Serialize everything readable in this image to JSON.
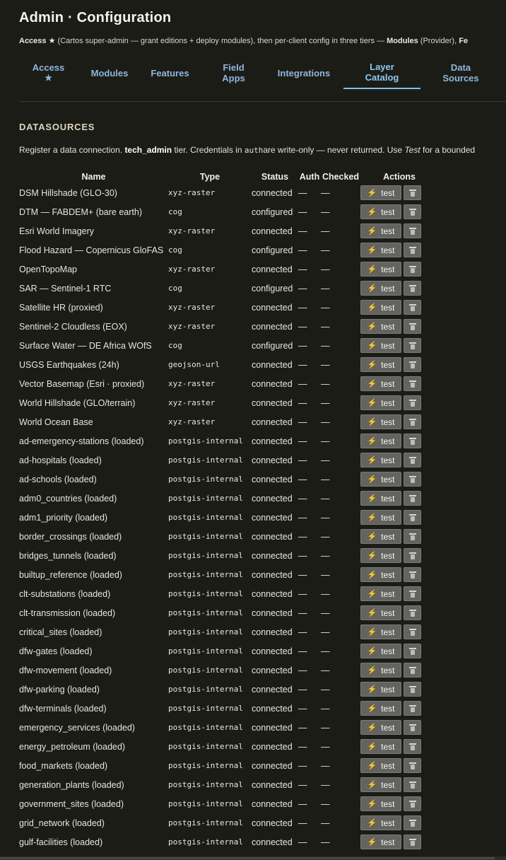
{
  "page": {
    "title": "Admin · Configuration",
    "intro": {
      "access_label": "Access",
      "star": "★",
      "access_text": " (Cartos super-admin — grant editions + deploy modules), then per-client config in three tiers — ",
      "modules_label": "Modules",
      "modules_text": " (Provider), ",
      "tail": "Fe"
    }
  },
  "tabs": [
    {
      "label": "Access",
      "sub": "★"
    },
    {
      "label": "Modules",
      "sub": ""
    },
    {
      "label": "Features",
      "sub": ""
    },
    {
      "label": "Field",
      "sub": "Apps"
    },
    {
      "label": "Integrations",
      "sub": ""
    },
    {
      "label": "Layer",
      "sub": "Catalog"
    },
    {
      "label": "Data",
      "sub": "Sources"
    }
  ],
  "active_tab": "Layer Catalog",
  "datasources": {
    "heading": "DATASOURCES",
    "desc": {
      "p1": "Register a data connection. ",
      "tier": "tech_admin",
      "p2": " tier. Credentials in ",
      "code": "auth",
      "p3": "are write-only — never returned. Use ",
      "test": "Test",
      "p4": " for a bounded"
    },
    "columns": [
      "Name",
      "Type",
      "Status",
      "Auth",
      "Checked",
      "Actions"
    ],
    "test_label": "test",
    "rows": [
      {
        "name": "DSM Hillshade (GLO-30)",
        "type": "xyz-raster",
        "status": "connected",
        "auth": "—",
        "checked": "—"
      },
      {
        "name": "DTM — FABDEM+ (bare earth)",
        "type": "cog",
        "status": "configured",
        "auth": "—",
        "checked": "—"
      },
      {
        "name": "Esri World Imagery",
        "type": "xyz-raster",
        "status": "connected",
        "auth": "—",
        "checked": "—"
      },
      {
        "name": "Flood Hazard — Copernicus GloFAS",
        "type": "cog",
        "status": "configured",
        "auth": "—",
        "checked": "—"
      },
      {
        "name": "OpenTopoMap",
        "type": "xyz-raster",
        "status": "connected",
        "auth": "—",
        "checked": "—"
      },
      {
        "name": "SAR — Sentinel-1 RTC",
        "type": "cog",
        "status": "configured",
        "auth": "—",
        "checked": "—"
      },
      {
        "name": "Satellite HR (proxied)",
        "type": "xyz-raster",
        "status": "connected",
        "auth": "—",
        "checked": "—"
      },
      {
        "name": "Sentinel-2 Cloudless (EOX)",
        "type": "xyz-raster",
        "status": "connected",
        "auth": "—",
        "checked": "—"
      },
      {
        "name": "Surface Water — DE Africa WOfS",
        "type": "cog",
        "status": "configured",
        "auth": "—",
        "checked": "—"
      },
      {
        "name": "USGS Earthquakes (24h)",
        "type": "geojson-url",
        "status": "connected",
        "auth": "—",
        "checked": "—"
      },
      {
        "name": "Vector Basemap (Esri · proxied)",
        "type": "xyz-raster",
        "status": "connected",
        "auth": "—",
        "checked": "—"
      },
      {
        "name": "World Hillshade (GLO/terrain)",
        "type": "xyz-raster",
        "status": "connected",
        "auth": "—",
        "checked": "—"
      },
      {
        "name": "World Ocean Base",
        "type": "xyz-raster",
        "status": "connected",
        "auth": "—",
        "checked": "—"
      },
      {
        "name": "ad-emergency-stations (loaded)",
        "type": "postgis-internal",
        "status": "connected",
        "auth": "—",
        "checked": "—"
      },
      {
        "name": "ad-hospitals (loaded)",
        "type": "postgis-internal",
        "status": "connected",
        "auth": "—",
        "checked": "—"
      },
      {
        "name": "ad-schools (loaded)",
        "type": "postgis-internal",
        "status": "connected",
        "auth": "—",
        "checked": "—"
      },
      {
        "name": "adm0_countries (loaded)",
        "type": "postgis-internal",
        "status": "connected",
        "auth": "—",
        "checked": "—"
      },
      {
        "name": "adm1_priority (loaded)",
        "type": "postgis-internal",
        "status": "connected",
        "auth": "—",
        "checked": "—"
      },
      {
        "name": "border_crossings (loaded)",
        "type": "postgis-internal",
        "status": "connected",
        "auth": "—",
        "checked": "—"
      },
      {
        "name": "bridges_tunnels (loaded)",
        "type": "postgis-internal",
        "status": "connected",
        "auth": "—",
        "checked": "—"
      },
      {
        "name": "builtup_reference (loaded)",
        "type": "postgis-internal",
        "status": "connected",
        "auth": "—",
        "checked": "—"
      },
      {
        "name": "clt-substations (loaded)",
        "type": "postgis-internal",
        "status": "connected",
        "auth": "—",
        "checked": "—"
      },
      {
        "name": "clt-transmission (loaded)",
        "type": "postgis-internal",
        "status": "connected",
        "auth": "—",
        "checked": "—"
      },
      {
        "name": "critical_sites (loaded)",
        "type": "postgis-internal",
        "status": "connected",
        "auth": "—",
        "checked": "—"
      },
      {
        "name": "dfw-gates (loaded)",
        "type": "postgis-internal",
        "status": "connected",
        "auth": "—",
        "checked": "—"
      },
      {
        "name": "dfw-movement (loaded)",
        "type": "postgis-internal",
        "status": "connected",
        "auth": "—",
        "checked": "—"
      },
      {
        "name": "dfw-parking (loaded)",
        "type": "postgis-internal",
        "status": "connected",
        "auth": "—",
        "checked": "—"
      },
      {
        "name": "dfw-terminals (loaded)",
        "type": "postgis-internal",
        "status": "connected",
        "auth": "—",
        "checked": "—"
      },
      {
        "name": "emergency_services (loaded)",
        "type": "postgis-internal",
        "status": "connected",
        "auth": "—",
        "checked": "—"
      },
      {
        "name": "energy_petroleum (loaded)",
        "type": "postgis-internal",
        "status": "connected",
        "auth": "—",
        "checked": "—"
      },
      {
        "name": "food_markets (loaded)",
        "type": "postgis-internal",
        "status": "connected",
        "auth": "—",
        "checked": "—"
      },
      {
        "name": "generation_plants (loaded)",
        "type": "postgis-internal",
        "status": "connected",
        "auth": "—",
        "checked": "—"
      },
      {
        "name": "government_sites (loaded)",
        "type": "postgis-internal",
        "status": "connected",
        "auth": "—",
        "checked": "—"
      },
      {
        "name": "grid_network (loaded)",
        "type": "postgis-internal",
        "status": "connected",
        "auth": "—",
        "checked": "—"
      },
      {
        "name": "gulf-facilities (loaded)",
        "type": "postgis-internal",
        "status": "connected",
        "auth": "—",
        "checked": "—"
      }
    ]
  },
  "icons": {
    "test": "lightning-icon",
    "delete": "trash-icon"
  },
  "colors": {
    "background": "#1c1c17",
    "tab_text": "#8fb6de",
    "active_tab_underline": "#7fc0ea",
    "bolt": "#ff8a3a",
    "button": "#636360"
  }
}
